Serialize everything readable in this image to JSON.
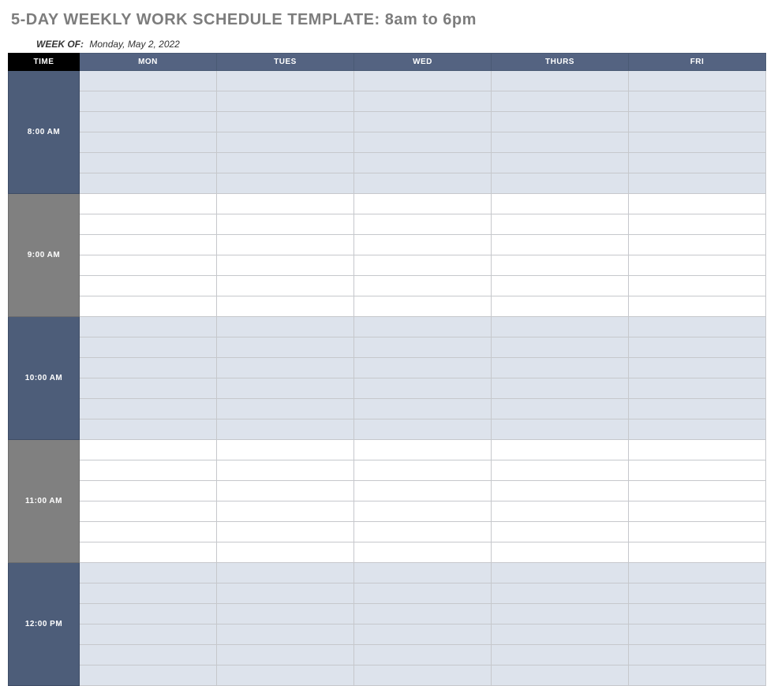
{
  "title": "5-DAY WEEKLY WORK SCHEDULE TEMPLATE: 8am to 6pm",
  "week_of_label": "WEEK OF:",
  "week_of_value": "Monday, May 2, 2022",
  "headers": {
    "time": "TIME",
    "days": [
      "MON",
      "TUES",
      "WED",
      "THURS",
      "FRI"
    ]
  },
  "time_blocks": [
    {
      "label": "8:00 AM",
      "style": "blue",
      "slots_per_day": 6
    },
    {
      "label": "9:00 AM",
      "style": "gray",
      "slots_per_day": 6
    },
    {
      "label": "10:00 AM",
      "style": "blue",
      "slots_per_day": 6
    },
    {
      "label": "11:00 AM",
      "style": "gray",
      "slots_per_day": 6
    },
    {
      "label": "12:00 PM",
      "style": "blue",
      "slots_per_day": 6
    }
  ]
}
